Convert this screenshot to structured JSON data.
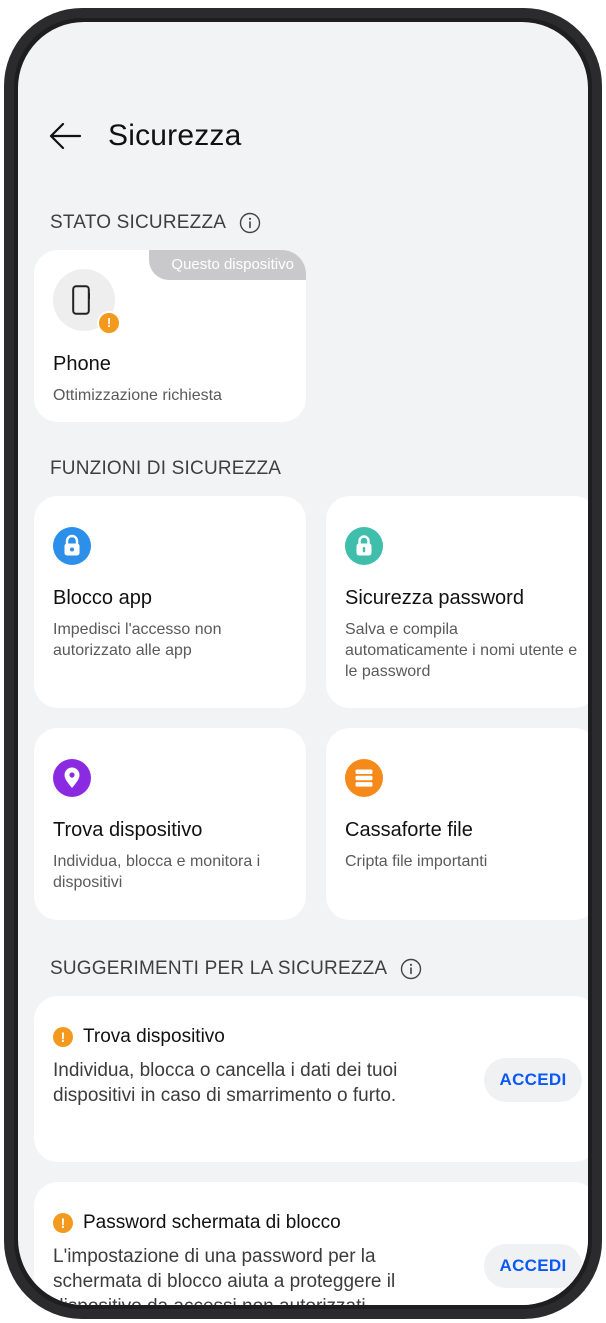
{
  "header": {
    "back_label": "back",
    "title": "Sicurezza"
  },
  "status_section": {
    "header": "STATO SICUREZZA",
    "device_card": {
      "badge": "Questo dispositivo",
      "title": "Phone",
      "subtitle": "Ottimizzazione richiesta",
      "warning_glyph": "!"
    }
  },
  "functions_section": {
    "header": "FUNZIONI DI SICUREZZA",
    "items": [
      {
        "title": "Blocco app",
        "description": "Impedisci l'accesso non autorizzato alle app",
        "icon": "lock-icon",
        "color": "#2c8fea"
      },
      {
        "title": "Sicurezza password",
        "description": "Salva e compila automaticamente i nomi utente e le password",
        "icon": "password-lock-icon",
        "color": "#3fbfab"
      },
      {
        "title": "Trova dispositivo",
        "description": "Individua, blocca e monitora i dispositivi",
        "icon": "location-pin-icon",
        "color": "#8a2be2"
      },
      {
        "title": "Cassaforte file",
        "description": "Cripta file importanti",
        "icon": "safe-icon",
        "color": "#f58a1a"
      }
    ]
  },
  "suggestions_section": {
    "header": "SUGGERIMENTI PER LA SICUREZZA",
    "items": [
      {
        "title": "Trova dispositivo",
        "description": "Individua, blocca o cancella i dati dei tuoi dispositivi in caso di smarrimento o furto.",
        "button": "ACCEDI"
      },
      {
        "title": "Password schermata di blocco",
        "description": "L'impostazione di una password per la schermata di blocco aiuta a proteggere il dispositivo da accessi non autorizzati.",
        "button": "ACCEDI"
      }
    ]
  },
  "colors": {
    "accent": "#0a59f7",
    "warning": "#f39a1e",
    "background": "#f1f3f5"
  }
}
